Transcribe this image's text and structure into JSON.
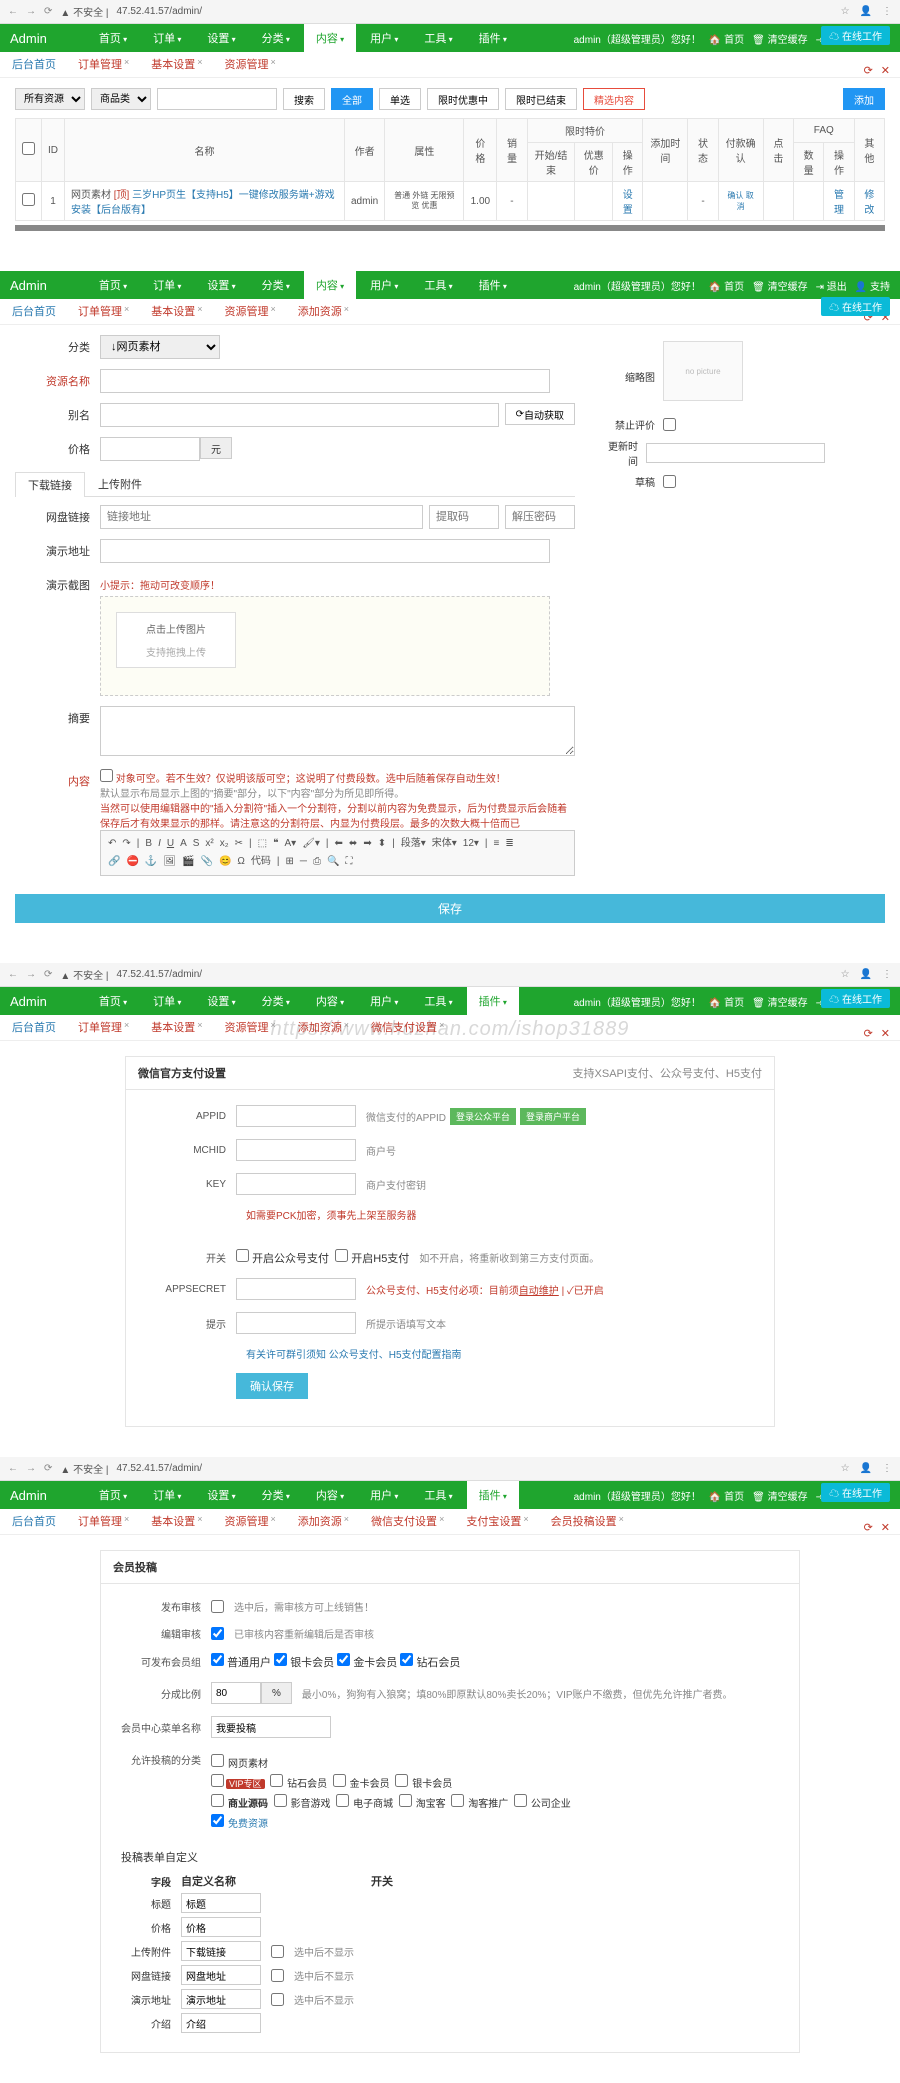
{
  "browser": {
    "url": "47.52.41.57/admin/",
    "unsafe": "不安全 |"
  },
  "brand": "Admin",
  "menu": [
    "首页",
    "订单",
    "设置",
    "分类",
    "内容",
    "用户",
    "工具",
    "插件"
  ],
  "user_text": "admin（超级管理员）您好！",
  "header_links": {
    "home": "首页",
    "cache": "清空缓存",
    "logout": "退出",
    "support": "支持"
  },
  "float_btn": "在线工作",
  "tabs1": [
    "后台首页",
    "订单管理",
    "基本设置",
    "资源管理"
  ],
  "tabs2": [
    "后台首页",
    "订单管理",
    "基本设置",
    "资源管理",
    "添加资源"
  ],
  "tabs3": [
    "后台首页",
    "订单管理",
    "基本设置",
    "资源管理",
    "添加资源",
    "微信支付设置"
  ],
  "tabs4": [
    "后台首页",
    "订单管理",
    "基本设置",
    "资源管理",
    "添加资源",
    "微信支付设置",
    "支付宝设置",
    "会员投稿设置"
  ],
  "filter": {
    "sel1": "所有资源",
    "sel2": "商品类",
    "search_placeholder": "",
    "btn_search": "搜索",
    "btn_all": "全部",
    "btn_single": "单选",
    "btn_limit": "限时优惠中",
    "btn_ended": "限时已结束",
    "btn_featured": "精选内容",
    "btn_add": "添加"
  },
  "th": {
    "id": "ID",
    "name": "名称",
    "author": "作者",
    "attr": "属性",
    "price": "价格",
    "sales": "销量",
    "limit": "限时特价",
    "start": "开始/结束",
    "origin": "优惠价",
    "op": "操作",
    "addtime": "添加时间",
    "status": "状态",
    "pay": "付款确认",
    "hits": "点击",
    "faq_count": "数量",
    "faq_op": "操作",
    "other": "其他",
    "limit_group": "限时特价",
    "faq_group": "FAQ"
  },
  "row1": {
    "id": "1",
    "cat": "网页素材",
    "name": "三岁HP页生【支持H5】一键修改服务端+游戏安装【后台版有】",
    "author": "admin",
    "attr": "普通 外链 无限预览 优惠",
    "price": "1.00",
    "sales": "-",
    "limit": "-",
    "op": "设置",
    "status": "-",
    "pay": "确认 取消",
    "hits": "",
    "faq": "管理",
    "other": "修改"
  },
  "form": {
    "cat_label": "分类",
    "cat_opt": "↓网页素材",
    "name_label": "资源名称",
    "alias_label": "别名",
    "alias_btn": "自动获取",
    "price_label": "价格",
    "price_unit": "元",
    "tab_download": "下载链接",
    "tab_upload": "上传附件",
    "netdisk_label": "网盘链接",
    "netdisk_ph1": "链接地址",
    "netdisk_ph2": "提取码",
    "netdisk_ph3": "解压密码",
    "demo_label": "演示地址",
    "imgs_label": "演示截图",
    "img_hint": "小提示：拖动可改变顺序！",
    "upload_btn": "点击上传图片",
    "upload_hint": "支持拖拽上传",
    "summary_label": "摘要",
    "content_label": "内容",
    "content_hint1": "对象可空。若不生效？仅说明该版可空；这说明了付费段数。选中后随着保存自动生效！",
    "content_hint2": "默认显示布局显示上图的\"摘要\"部分，以下\"内容\"部分为所见即所得。",
    "content_hint3": "当然可以使用编辑器中的\"插入分割符\"插入一个分割符，分割以前内容为免费显示，后为付费显示后会随着保存后才有效果显示的那样。请注意这的分割符层、内显为付费段层。最多的次数大概十倍而已",
    "save_btn": "保存"
  },
  "side": {
    "thumb_label": "缩略图",
    "thumb_ph": "no picture",
    "forbid_label": "禁止评价",
    "update_label": "更新时间",
    "draft_label": "草稿"
  },
  "wechat": {
    "title": "微信官方支付设置",
    "title_right": "支持XSAPI支付、公众号支付、H5支付",
    "appid": "APPID",
    "appid_hint": "微信支付的APPID",
    "btn1": "登录公众平台",
    "btn2": "登录商户平台",
    "mchid": "MCHID",
    "mchid_hint": "商户号",
    "key": "KEY",
    "key_hint": "商户支付密钥",
    "cert_hint": "如需要PCK加密，须事先上架至服务器",
    "switch": "开关",
    "switch1": "开启公众号支付",
    "switch2": "开启H5支付",
    "switch_hint": "如不开启，将重新收到第三方支付页面。",
    "appsecret": "APPSECRET",
    "appsecret_hint": "公众号支付、H5支付必项：目前须自动维护 | ✓已开启",
    "link": "自动维护",
    "prompt": "提示",
    "prompt_hint": "所提示语填写文本",
    "links_hint": "有关许可群引须知   公众号支付、H5支付配置指南",
    "submit": "确认保存"
  },
  "submit_panel": {
    "title": "会员投稿",
    "publish_label": "发布审核",
    "publish_opt": "选中后，需审核方可上线销售！",
    "edit_label": "编辑审核",
    "edit_opt": "已审核内容重新编辑后是否审核",
    "levels_label": "可发布会员组",
    "lv1": "普通用户",
    "lv2": "银卡会员",
    "lv3": "金卡会员",
    "lv4": "钻石会员",
    "ratio_label": "分成比例",
    "ratio_val": "80",
    "ratio_unit": "%",
    "ratio_hint": "最小0%，狗狗有入狼窝；填80%即原默认80%卖长20%；VIP账户不缴费，但优先允许推广者费。",
    "menu_label": "会员中心菜单名称",
    "menu_val": "我要投稿",
    "cats_label": "允许投稿的分类",
    "cats": [
      "网页素材",
      "VIP专区",
      "商业源码",
      "免费资源"
    ],
    "subcats": {
      "vip": [
        "钻石会员",
        "金卡会员",
        "银卡会员"
      ],
      "biz": [
        "影音游戏",
        "电子商城",
        "淘宝客",
        "淘客推广",
        "公司企业"
      ]
    },
    "custom_title": "投稿表单自定义",
    "fh_field": "字段",
    "fh_name": "自定义名称",
    "fh_switch": "开关",
    "f_title": "标题",
    "f_title_v": "标题",
    "f_price": "价格",
    "f_price_v": "价格",
    "f_upload": "上传附件",
    "f_upload_v": "下载链接",
    "f_upload_h": "选中后不显示",
    "f_netdisk": "网盘链接",
    "f_netdisk_v": "网盘地址",
    "f_netdisk_h": "选中后不显示",
    "f_demo": "演示地址",
    "f_demo_v": "演示地址",
    "f_demo_h": "选中后不显示",
    "f_intro": "介绍",
    "f_intro_v": "介绍"
  },
  "watermark": "https://www.huzhan.com/ishop31889"
}
